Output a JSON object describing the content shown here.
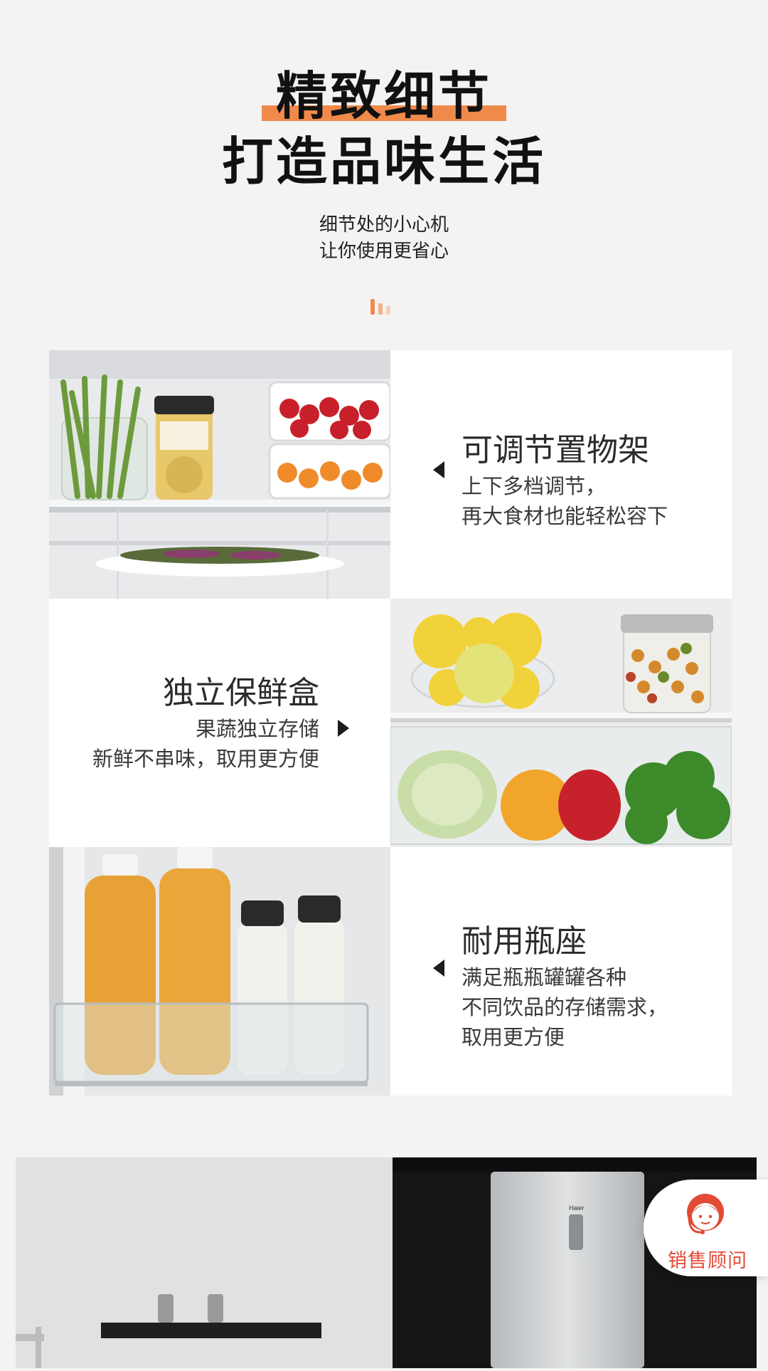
{
  "header": {
    "title_line1": "精致细节",
    "title_line2": "打造品味生活",
    "subtitle_line1": "细节处的小心机",
    "subtitle_line2": "让你使用更省心"
  },
  "features": [
    {
      "title": "可调节置物架",
      "desc_line1": "上下多档调节，",
      "desc_line2": "再大食材也能轻松容下"
    },
    {
      "title": "独立保鲜盒",
      "desc_line1": "果蔬独立存储",
      "desc_line2": "新鲜不串味，取用更方便"
    },
    {
      "title": "耐用瓶座",
      "desc_line1": "满足瓶瓶罐罐各种",
      "desc_line2": "不同饮品的存储需求，",
      "desc_line3": "取用更方便"
    }
  ],
  "product": {
    "brand": "Haier"
  },
  "consult": {
    "label": "销售顾问"
  },
  "colors": {
    "accent": "#f08a4b",
    "consult_red": "#e24a36",
    "background": "#f4f3f2"
  },
  "icons": [
    "arrow-left-icon",
    "arrow-right-icon",
    "customer-service-icon"
  ]
}
